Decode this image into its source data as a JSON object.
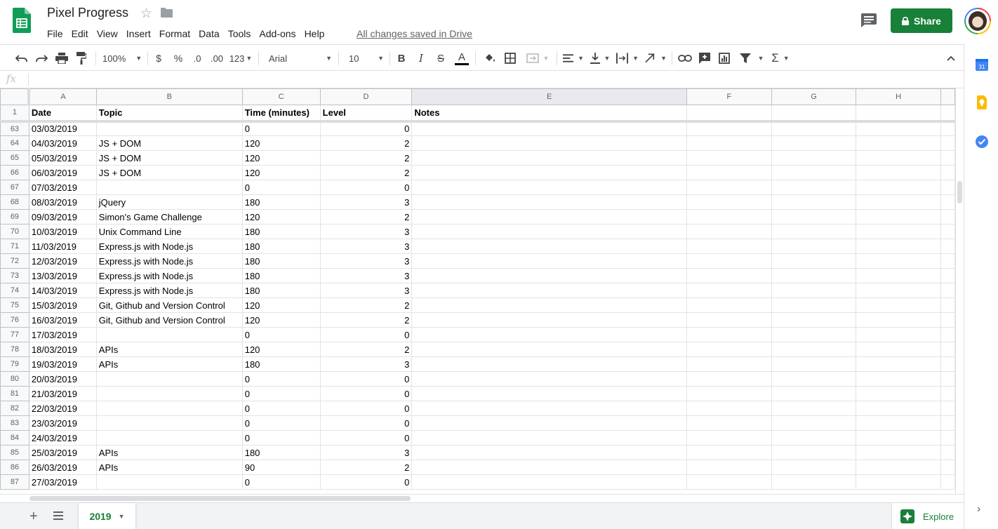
{
  "title": "Pixel Progress",
  "menu": [
    "File",
    "Edit",
    "View",
    "Insert",
    "Format",
    "Data",
    "Tools",
    "Add-ons",
    "Help"
  ],
  "save_status": "All changes saved in Drive",
  "share_label": "Share",
  "toolbar": {
    "zoom": "100%",
    "currency": "$",
    "percent": "%",
    "decrease_decimals": ".0",
    "increase_decimals": ".00",
    "more_formats": "123",
    "font": "Arial",
    "font_size": "10"
  },
  "formula_icon": "fx",
  "columns": [
    "A",
    "B",
    "C",
    "D",
    "E",
    "F",
    "G",
    "H"
  ],
  "header_row": {
    "num": "1",
    "cells": [
      "Date",
      "Topic",
      "Time (minutes)",
      "Level",
      "Notes"
    ]
  },
  "rows": [
    {
      "num": "63",
      "date": "03/03/2019",
      "topic": "",
      "time": "0",
      "level": "0"
    },
    {
      "num": "64",
      "date": "04/03/2019",
      "topic": "JS + DOM",
      "time": "120",
      "level": "2"
    },
    {
      "num": "65",
      "date": "05/03/2019",
      "topic": "JS + DOM",
      "time": "120",
      "level": "2"
    },
    {
      "num": "66",
      "date": "06/03/2019",
      "topic": "JS + DOM",
      "time": "120",
      "level": "2"
    },
    {
      "num": "67",
      "date": "07/03/2019",
      "topic": "",
      "time": "0",
      "level": "0"
    },
    {
      "num": "68",
      "date": "08/03/2019",
      "topic": "jQuery",
      "time": "180",
      "level": "3"
    },
    {
      "num": "69",
      "date": "09/03/2019",
      "topic": "Simon's Game Challenge",
      "time": "120",
      "level": "2"
    },
    {
      "num": "70",
      "date": "10/03/2019",
      "topic": "Unix Command Line",
      "time": "180",
      "level": "3"
    },
    {
      "num": "71",
      "date": "11/03/2019",
      "topic": "Express.js with Node.js",
      "time": "180",
      "level": "3"
    },
    {
      "num": "72",
      "date": "12/03/2019",
      "topic": "Express.js with Node.js",
      "time": "180",
      "level": "3"
    },
    {
      "num": "73",
      "date": "13/03/2019",
      "topic": "Express.js with Node.js",
      "time": "180",
      "level": "3"
    },
    {
      "num": "74",
      "date": "14/03/2019",
      "topic": "Express.js with Node.js",
      "time": "180",
      "level": "3"
    },
    {
      "num": "75",
      "date": "15/03/2019",
      "topic": "Git, Github and Version Control",
      "time": "120",
      "level": "2"
    },
    {
      "num": "76",
      "date": "16/03/2019",
      "topic": "Git, Github and Version Control",
      "time": "120",
      "level": "2"
    },
    {
      "num": "77",
      "date": "17/03/2019",
      "topic": "",
      "time": "0",
      "level": "0"
    },
    {
      "num": "78",
      "date": "18/03/2019",
      "topic": "APIs",
      "time": "120",
      "level": "2"
    },
    {
      "num": "79",
      "date": "19/03/2019",
      "topic": "APIs",
      "time": "180",
      "level": "3"
    },
    {
      "num": "80",
      "date": "20/03/2019",
      "topic": "",
      "time": "0",
      "level": "0"
    },
    {
      "num": "81",
      "date": "21/03/2019",
      "topic": "",
      "time": "0",
      "level": "0"
    },
    {
      "num": "82",
      "date": "22/03/2019",
      "topic": "",
      "time": "0",
      "level": "0"
    },
    {
      "num": "83",
      "date": "23/03/2019",
      "topic": "",
      "time": "0",
      "level": "0"
    },
    {
      "num": "84",
      "date": "24/03/2019",
      "topic": "",
      "time": "0",
      "level": "0"
    },
    {
      "num": "85",
      "date": "25/03/2019",
      "topic": "APIs",
      "time": "180",
      "level": "3"
    },
    {
      "num": "86",
      "date": "26/03/2019",
      "topic": "APIs",
      "time": "90",
      "level": "2"
    },
    {
      "num": "87",
      "date": "27/03/2019",
      "topic": "",
      "time": "0",
      "level": "0"
    }
  ],
  "sheet_tab": "2019",
  "explore_label": "Explore",
  "colors": {
    "brand_green": "#188038",
    "sheets_green": "#0f9d58",
    "header_bg": "#f8f9fa"
  }
}
